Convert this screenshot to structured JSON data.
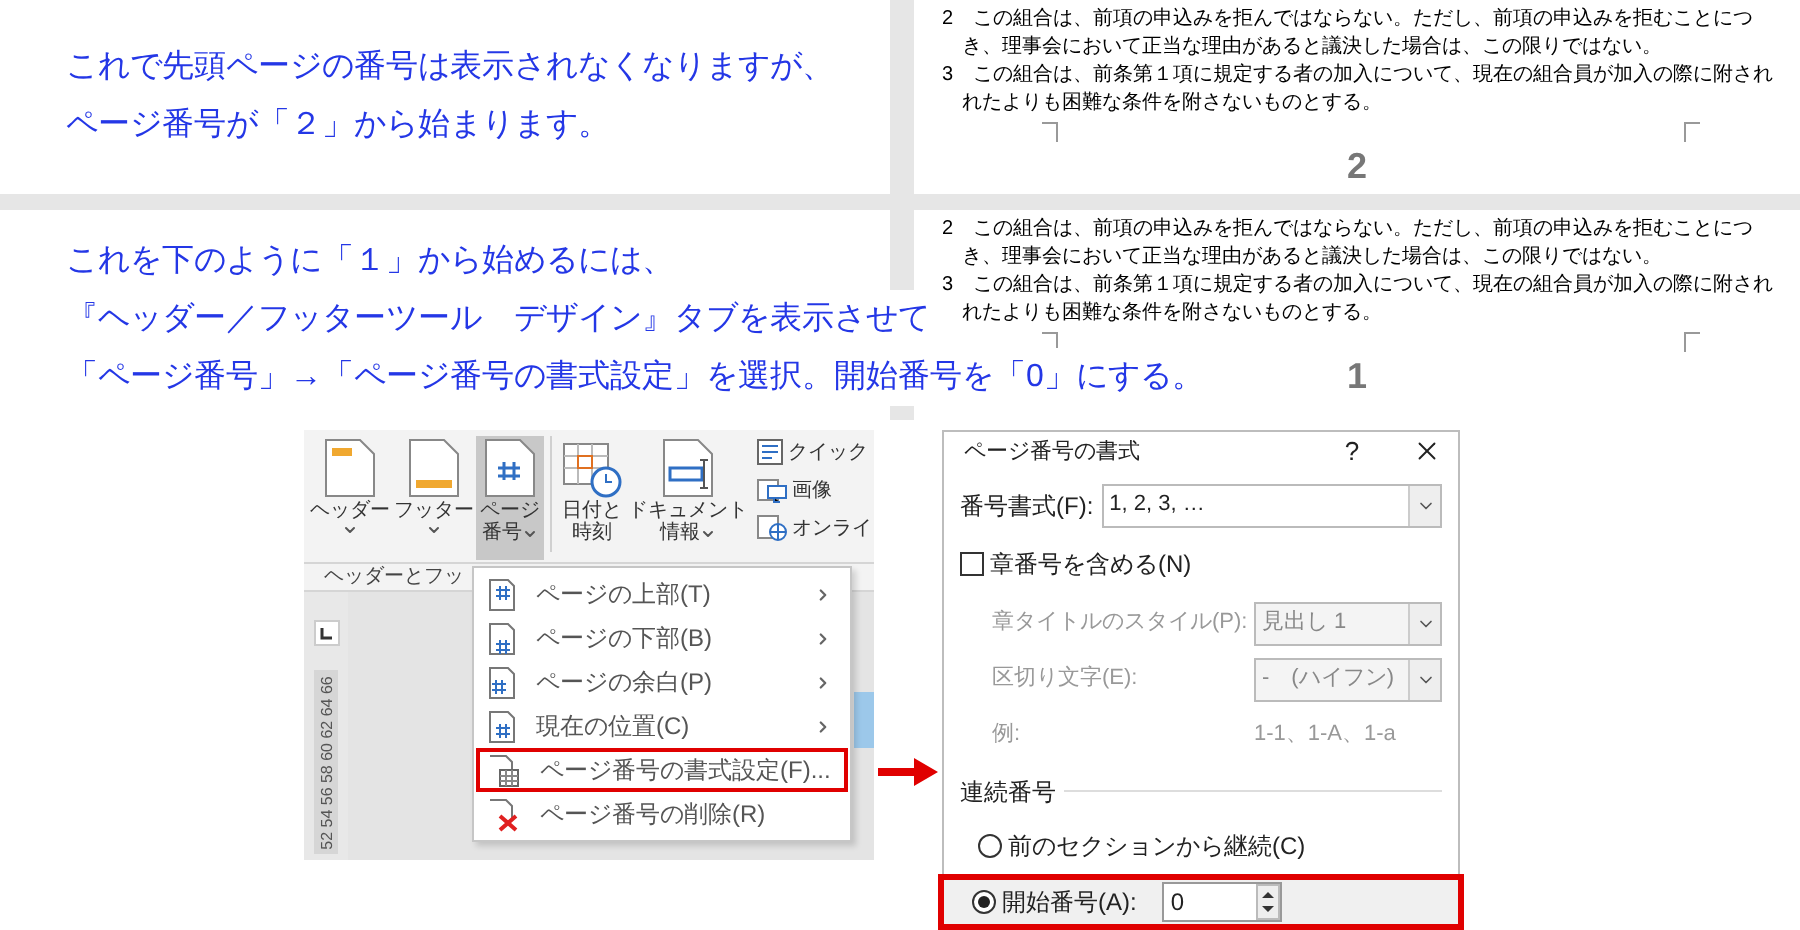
{
  "notes": [
    {
      "lines": [
        "これで先頭ページの番号は表示されなくなりますが、",
        "ページ番号が「２」から始まります。"
      ]
    },
    {
      "lines": [
        "これを下のように「１」から始めるには、",
        "『ヘッダー／フッターツール　デザイン』タブを表示させて",
        "「ページ番号」→「ページ番号の書式設定」を選択。開始番号を「0」にする。"
      ]
    }
  ],
  "document_pages": [
    {
      "page_number": "2",
      "lines": [
        {
          "text": "2　この組合は、前項の申込みを拒んではならない。ただし、前項の申込みを拒むことにつ",
          "indent": false
        },
        {
          "text": "き、理事会において正当な理由があると議決した場合は、この限りではない。",
          "indent": true
        },
        {
          "text": "3　この組合は、前条第１項に規定する者の加入について、現在の組合員が加入の際に附され",
          "indent": false
        },
        {
          "text": "れたよりも困難な条件を附さないものとする。",
          "indent": true
        }
      ]
    },
    {
      "page_number": "1",
      "lines": [
        {
          "text": "2　この組合は、前項の申込みを拒んではならない。ただし、前項の申込みを拒むことにつ",
          "indent": false
        },
        {
          "text": "き、理事会において正当な理由があると議決した場合は、この限りではない。",
          "indent": true
        },
        {
          "text": "3　この組合は、前条第１項に規定する者の加入について、現在の組合員が加入の際に附され",
          "indent": false
        },
        {
          "text": "れたよりも困難な条件を附さないものとする。",
          "indent": true
        }
      ]
    }
  ],
  "ribbon": {
    "large_buttons": [
      {
        "kind": "header",
        "lines": [
          "ヘッダー"
        ],
        "caret_below": true,
        "caret_inline": false,
        "selected": false
      },
      {
        "kind": "footer",
        "lines": [
          "フッター"
        ],
        "caret_below": true,
        "caret_inline": false,
        "selected": false
      },
      {
        "kind": "page_number",
        "lines": [
          "ページ",
          "番号"
        ],
        "caret_below": false,
        "caret_inline": true,
        "selected": true
      },
      {
        "kind": "date",
        "lines": [
          "日付と",
          "時刻"
        ],
        "caret_below": false,
        "caret_inline": false,
        "selected": false
      },
      {
        "kind": "doc_info",
        "lines": [
          "ドキュメント",
          "情報"
        ],
        "caret_below": false,
        "caret_inline": true,
        "selected": false
      }
    ],
    "small_buttons": [
      {
        "kind": "quick",
        "label": "クイック"
      },
      {
        "kind": "image",
        "label": "画像"
      },
      {
        "kind": "online",
        "label": "オンライ"
      }
    ],
    "group_label": "ヘッダーとフッ",
    "ruler_numbers": "52 54 56 58 60 62 64 66"
  },
  "menu": {
    "items": [
      {
        "kind": "top",
        "label": "ページの上部(T)",
        "submenu": true,
        "highlighted": false
      },
      {
        "kind": "bottom",
        "label": "ページの下部(B)",
        "submenu": true,
        "highlighted": false
      },
      {
        "kind": "margin",
        "label": "ページの余白(P)",
        "submenu": true,
        "highlighted": false
      },
      {
        "kind": "current",
        "label": "現在の位置(C)",
        "submenu": true,
        "highlighted": false
      },
      {
        "kind": "format",
        "label": "ページ番号の書式設定(F)...",
        "submenu": false,
        "highlighted": true
      },
      {
        "kind": "delete",
        "label": "ページ番号の削除(R)",
        "submenu": false,
        "highlighted": false
      }
    ]
  },
  "dialog": {
    "title": "ページ番号の書式",
    "help": "?",
    "number_format": {
      "label": "番号書式(F):",
      "value": "1, 2, 3, …"
    },
    "include_chapter": {
      "label": "章番号を含める(N)",
      "checked": false
    },
    "chapter_fields": [
      {
        "kind": "select",
        "label": "章タイトルのスタイル(P):",
        "value": "見出し 1",
        "disabled": true
      },
      {
        "kind": "select",
        "label": "区切り文字(E):",
        "value": "-　(ハイフン)",
        "disabled": true
      },
      {
        "kind": "example",
        "label": "例:",
        "value": "1-1、1-A、1-a",
        "disabled": true
      }
    ],
    "section_title": "連続番号",
    "options": [
      {
        "kind": "continue",
        "label": "前のセクションから継続(C)",
        "selected": false,
        "highlighted": false
      },
      {
        "kind": "start",
        "label": "開始番号(A):",
        "value": "0",
        "selected": true,
        "highlighted": true
      }
    ]
  }
}
